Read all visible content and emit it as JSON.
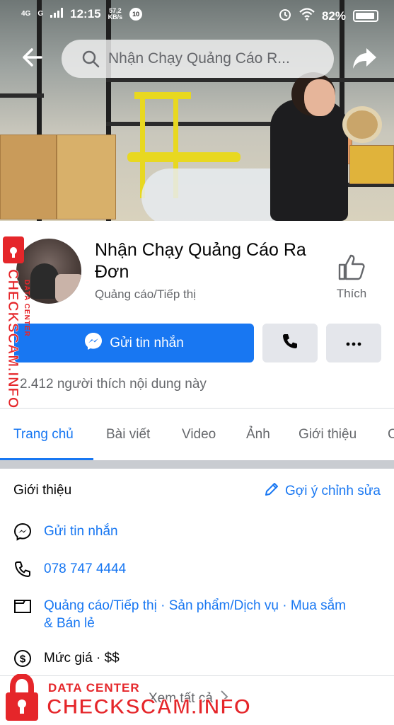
{
  "status_bar": {
    "network_1": "4G",
    "network_2": "G",
    "time": "12:15",
    "speed_value": "57,2",
    "speed_unit": "KB/s",
    "badge": "10",
    "battery": "82%"
  },
  "search": {
    "placeholder": "Nhận Chạy Quảng Cáo R..."
  },
  "page": {
    "name": "Nhận Chạy Quảng Cáo Ra Đơn",
    "category": "Quảng cáo/Tiếp thị",
    "like_label": "Thích",
    "message_button": "Gửi tin nhắn",
    "likes_count": "2.412 người thích nội dung này"
  },
  "tabs": [
    {
      "label": "Trang chủ"
    },
    {
      "label": "Bài viết"
    },
    {
      "label": "Video"
    },
    {
      "label": "Ảnh"
    },
    {
      "label": "Giới thiệu"
    },
    {
      "label": "C"
    }
  ],
  "about": {
    "title": "Giới thiệu",
    "edit_label": "Gợi ý chỉnh sửa",
    "message": "Gửi tin nhắn",
    "phone": "078 747 4444",
    "categories": "Quảng cáo/Tiếp thị · Sản phẩm/Dịch vụ · Mua sắm & Bán lẻ",
    "price": "Mức giá · $$",
    "see_all": "Xem tất cả"
  },
  "watermark": {
    "vertical_text": "CHECKSCAM.INFO",
    "vertical_small": "DATA CENTER",
    "bottom_top": "DATA CENTER",
    "bottom_main": "CHECKSCAM.INFO"
  },
  "colors": {
    "accent": "#1877f2",
    "watermark": "#e5262a",
    "secondary_button": "#e4e6eb",
    "muted_text": "#65676b"
  }
}
